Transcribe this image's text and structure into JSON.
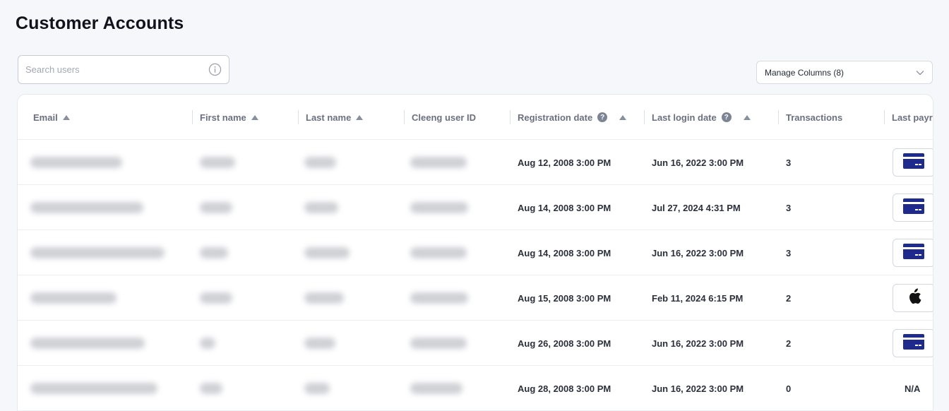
{
  "page": {
    "title": "Customer Accounts"
  },
  "search": {
    "placeholder": "Search users",
    "value": ""
  },
  "manage_columns": {
    "label": "Manage Columns (8)"
  },
  "table": {
    "columns": [
      {
        "label": "Email",
        "sortable": true
      },
      {
        "label": "First name",
        "sortable": true
      },
      {
        "label": "Last name",
        "sortable": true
      },
      {
        "label": "Cleeng user ID",
        "sortable": false
      },
      {
        "label": "Registration date",
        "sortable": true,
        "help": "?"
      },
      {
        "label": "Last login date",
        "sortable": true,
        "help": "?"
      },
      {
        "label": "Transactions",
        "sortable": false
      },
      {
        "label": "Last payr",
        "sortable": false
      }
    ],
    "rows": [
      {
        "registration_date": "Aug 12, 2008 3:00 PM",
        "last_login_date": "Jun 16, 2022 3:00 PM",
        "transactions": "3",
        "last_payment": "card-icon"
      },
      {
        "registration_date": "Aug 14, 2008 3:00 PM",
        "last_login_date": "Jul 27, 2024 4:31 PM",
        "transactions": "3",
        "last_payment": "card-icon"
      },
      {
        "registration_date": "Aug 14, 2008 3:00 PM",
        "last_login_date": "Jun 16, 2022 3:00 PM",
        "transactions": "3",
        "last_payment": "card-icon"
      },
      {
        "registration_date": "Aug 15, 2008 3:00 PM",
        "last_login_date": "Feb 11, 2024 6:15 PM",
        "transactions": "2",
        "last_payment": "apple-icon"
      },
      {
        "registration_date": "Aug 26, 2008 3:00 PM",
        "last_login_date": "Jun 16, 2022 3:00 PM",
        "transactions": "2",
        "last_payment": "card-icon"
      },
      {
        "registration_date": "Aug 28, 2008 3:00 PM",
        "last_login_date": "Jun 16, 2022 3:00 PM",
        "transactions": "0",
        "last_payment": "N/A"
      }
    ]
  },
  "colors": {
    "card_icon": "#1e2a8c",
    "accent_text": "#10131c",
    "header_text": "#6b7080"
  }
}
